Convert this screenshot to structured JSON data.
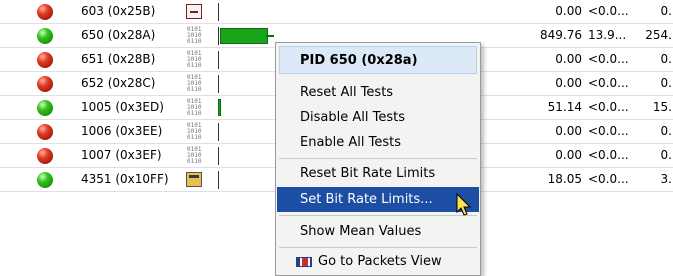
{
  "rows": [
    {
      "status": "red",
      "pid": "603 (0x25B)",
      "icon": "minimize",
      "c1": "0.00",
      "c2": "<0.0...",
      "c3": "0."
    },
    {
      "status": "green",
      "pid": "650 (0x28A)",
      "icon": "binary",
      "c1": "849.76",
      "c2": "13.9...",
      "c3": "254.",
      "bar_fraction": 0.85
    },
    {
      "status": "red",
      "pid": "651 (0x28B)",
      "icon": "binary",
      "c1": "0.00",
      "c2": "<0.0...",
      "c3": "0."
    },
    {
      "status": "red",
      "pid": "652 (0x28C)",
      "icon": "binary",
      "c1": "0.00",
      "c2": "<0.0...",
      "c3": "0."
    },
    {
      "status": "green",
      "pid": "1005 (0x3ED)",
      "icon": "binary",
      "c1": "51.14",
      "c2": "<0.0...",
      "c3": "15."
    },
    {
      "status": "red",
      "pid": "1006 (0x3EE)",
      "icon": "binary",
      "c1": "0.00",
      "c2": "<0.0...",
      "c3": "0."
    },
    {
      "status": "red",
      "pid": "1007 (0x3EF)",
      "icon": "binary",
      "c1": "0.00",
      "c2": "<0.0...",
      "c3": "0."
    },
    {
      "status": "green",
      "pid": "4351 (0x10FF)",
      "icon": "calculator",
      "c1": "18.05",
      "c2": "<0.0...",
      "c3": "3."
    }
  ],
  "context_menu": {
    "header": "PID 650 (0x28a)",
    "items": [
      {
        "label": "Reset All Tests"
      },
      {
        "label": "Disable All Tests"
      },
      {
        "label": "Enable All Tests"
      },
      {
        "label": "Reset Bit Rate Limits"
      },
      {
        "label": "Set Bit Rate Limits...",
        "highlighted": true
      },
      {
        "label": "Show Mean Values"
      },
      {
        "label": "Go to Packets View",
        "icon": "packets-icon"
      }
    ]
  },
  "colors": {
    "highlight": "#1c4ea3",
    "header_bg": "#dce9f7",
    "bar": "#18a418",
    "status_red": "#e23a22",
    "status_green": "#37c21a"
  }
}
